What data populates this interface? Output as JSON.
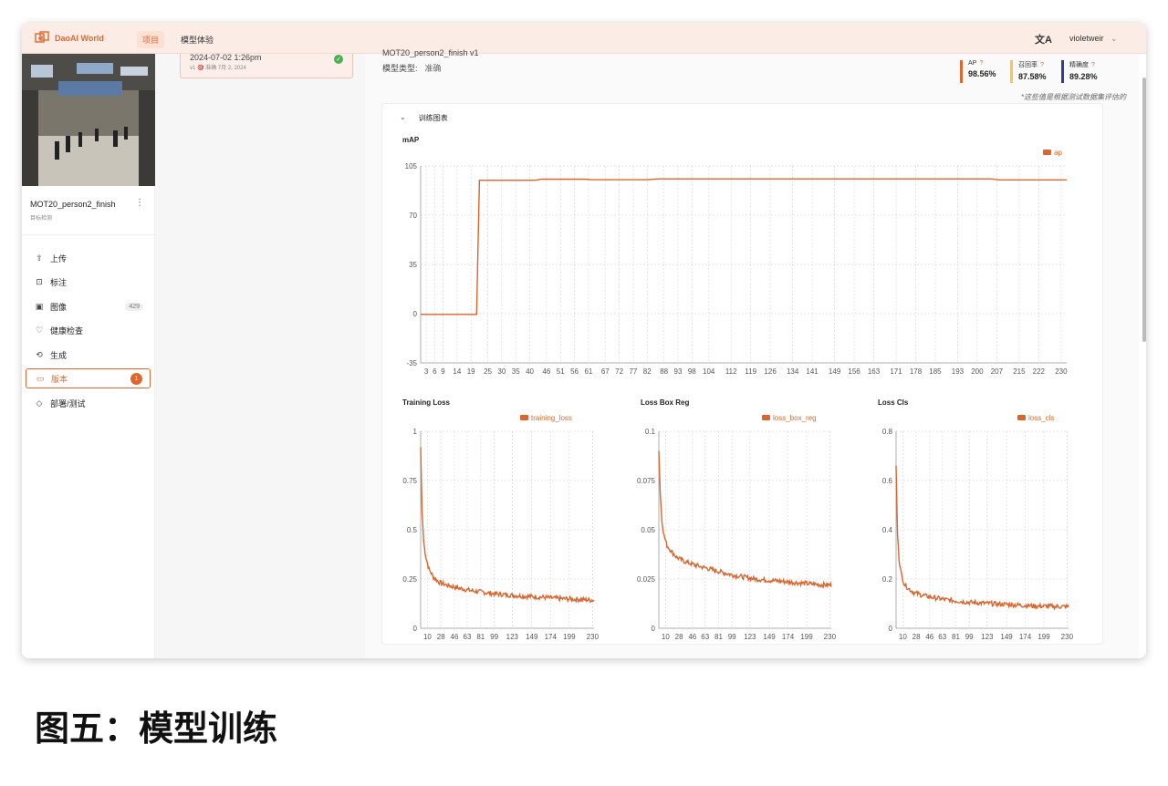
{
  "topbar": {
    "brand": "DaoAI World",
    "nav": [
      "项目",
      "模型体验"
    ],
    "lang_icon": "translate-icon",
    "user": "violetweir",
    "lang_glyph": "文A",
    "user_caret": "⌄"
  },
  "sidebar": {
    "project_name": "MOT20_person2_finish",
    "project_type": "目标检测",
    "menu": [
      {
        "label": "上传",
        "icon": "upload-icon",
        "glyph": "⇧"
      },
      {
        "label": "标注",
        "icon": "annotate-icon",
        "glyph": "⊡"
      },
      {
        "label": "图像",
        "icon": "image-icon",
        "glyph": "▣",
        "badge": "429"
      },
      {
        "label": "健康检查",
        "icon": "health-icon",
        "glyph": "♡"
      },
      {
        "label": "生成",
        "icon": "generate-icon",
        "glyph": "⟲"
      },
      {
        "label": "版本",
        "icon": "folder-icon",
        "glyph": "▭",
        "badge": "1"
      },
      {
        "label": "部署/测试",
        "icon": "tag-icon",
        "glyph": "◇"
      }
    ]
  },
  "version_card": {
    "title": "2024-07-02 1:26pm",
    "subtitle": "v1 🎯 准确 7月 2, 2024"
  },
  "main": {
    "model_title": "MOT20_person2_finish v1",
    "model_type_label": "模型类型:",
    "model_type_value": "准确",
    "metrics": [
      {
        "label": "AP",
        "value": "98.56%",
        "color": "#e0662e"
      },
      {
        "label": "召回率",
        "value": "87.58%",
        "color": "#f2c94c"
      },
      {
        "label": "精确度",
        "value": "89.28%",
        "color": "#2d3e9c"
      }
    ],
    "note": "*这些值是根据测试数据集评估的",
    "panel_title": "训练图表"
  },
  "caption": "图五：模型训练",
  "colors": {
    "accent": "#e0662e",
    "series": "#d9662f"
  },
  "chart_data": [
    {
      "type": "line",
      "title": "mAP",
      "series": [
        {
          "name": "ap",
          "x": [
            1,
            19,
            21,
            22,
            30,
            42,
            44,
            60,
            62,
            82,
            86,
            160,
            205,
            208,
            232
          ],
          "y": [
            -0.5,
            -0.5,
            -0.5,
            94.8,
            94.8,
            94.8,
            95.6,
            95.6,
            95.2,
            95.2,
            95.8,
            95.8,
            95.8,
            95.1,
            95.1
          ]
        }
      ],
      "xlim": [
        1,
        232
      ],
      "ylim": [
        -35,
        105
      ],
      "yticks": [
        -35,
        0,
        35,
        70,
        105
      ],
      "xticks": [
        3,
        6,
        9,
        14,
        19,
        25,
        30,
        35,
        40,
        46,
        51,
        56,
        61,
        67,
        72,
        77,
        82,
        88,
        93,
        98,
        104,
        112,
        119,
        126,
        134,
        141,
        149,
        156,
        163,
        171,
        178,
        185,
        193,
        200,
        207,
        215,
        222,
        230
      ],
      "grid": true,
      "legend": "top-right"
    },
    {
      "type": "line",
      "title": "Training Loss",
      "series": [
        {
          "name": "training_loss",
          "x": [
            1,
            3,
            5,
            8,
            12,
            18,
            25,
            35,
            50,
            70,
            100,
            130,
            160,
            190,
            220,
            232
          ],
          "y": [
            0.92,
            0.58,
            0.44,
            0.36,
            0.3,
            0.26,
            0.235,
            0.22,
            0.205,
            0.19,
            0.175,
            0.165,
            0.158,
            0.15,
            0.145,
            0.142
          ]
        }
      ],
      "xlim": [
        1,
        232
      ],
      "ylim": [
        0,
        1
      ],
      "yticks": [
        0,
        0.25,
        0.5,
        0.75,
        1
      ],
      "xticks": [
        10,
        28,
        46,
        63,
        81,
        99,
        123,
        149,
        174,
        199,
        230
      ],
      "grid": true,
      "legend": "top-right"
    },
    {
      "type": "line",
      "title": "Loss Box Reg",
      "series": [
        {
          "name": "loss_box_reg",
          "x": [
            1,
            3,
            5,
            8,
            12,
            18,
            25,
            35,
            50,
            70,
            100,
            130,
            160,
            190,
            220,
            232
          ],
          "y": [
            0.09,
            0.068,
            0.055,
            0.047,
            0.042,
            0.039,
            0.036,
            0.034,
            0.032,
            0.03,
            0.027,
            0.025,
            0.024,
            0.023,
            0.022,
            0.022
          ]
        }
      ],
      "xlim": [
        1,
        232
      ],
      "ylim": [
        0,
        0.1
      ],
      "yticks": [
        0,
        0.025,
        0.05,
        0.075,
        0.1
      ],
      "xticks": [
        10,
        28,
        46,
        63,
        81,
        99,
        123,
        149,
        174,
        199,
        230
      ],
      "grid": true,
      "legend": "top-right"
    },
    {
      "type": "line",
      "title": "Loss Cls",
      "series": [
        {
          "name": "loss_cls",
          "x": [
            1,
            3,
            5,
            8,
            12,
            18,
            25,
            35,
            50,
            70,
            100,
            130,
            160,
            190,
            220,
            232
          ],
          "y": [
            0.66,
            0.38,
            0.28,
            0.22,
            0.18,
            0.16,
            0.145,
            0.135,
            0.125,
            0.115,
            0.105,
            0.1,
            0.095,
            0.09,
            0.088,
            0.087
          ]
        }
      ],
      "xlim": [
        1,
        232
      ],
      "ylim": [
        0,
        0.8
      ],
      "yticks": [
        0,
        0.2,
        0.4,
        0.6,
        0.8
      ],
      "xticks": [
        10,
        28,
        46,
        63,
        81,
        99,
        123,
        149,
        174,
        199,
        230
      ],
      "grid": true,
      "legend": "top-right"
    }
  ]
}
